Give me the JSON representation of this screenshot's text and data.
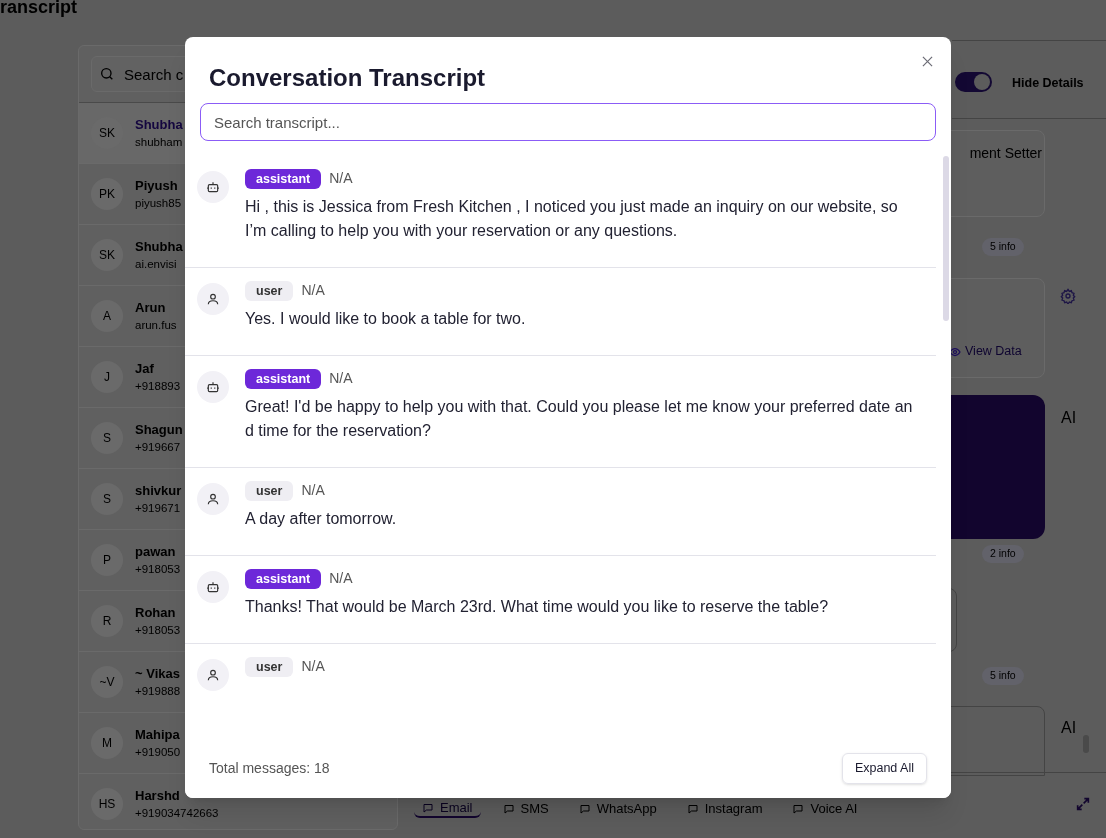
{
  "page": {
    "title": "ranscript"
  },
  "contacts_search": {
    "placeholder": "Search c"
  },
  "contacts": [
    {
      "initials": "SK",
      "name": "Shubha",
      "detail": "shubham",
      "selected": true
    },
    {
      "initials": "PK",
      "name": "Piyush",
      "detail": "piyush85",
      "selected": false
    },
    {
      "initials": "SK",
      "name": "Shubha",
      "detail": "ai.envisi",
      "selected": false
    },
    {
      "initials": "A",
      "name": "Arun",
      "detail": "arun.fus",
      "selected": false
    },
    {
      "initials": "J",
      "name": "Jaf",
      "detail": "+918893",
      "selected": false
    },
    {
      "initials": "S",
      "name": "Shagun",
      "detail": "+919667",
      "selected": false
    },
    {
      "initials": "S",
      "name": "shivkur",
      "detail": "+919671",
      "selected": false
    },
    {
      "initials": "P",
      "name": "pawan",
      "detail": "+918053",
      "selected": false
    },
    {
      "initials": "R",
      "name": "Rohan",
      "detail": "+918053",
      "selected": false
    },
    {
      "initials": "~V",
      "name": "~ Vikas",
      "detail": "+919888",
      "selected": false
    },
    {
      "initials": "M",
      "name": "Mahipa",
      "detail": "+919050",
      "selected": false
    },
    {
      "initials": "HS",
      "name": "Harshd",
      "detail": "+919034742663",
      "selected": false
    }
  ],
  "details": {
    "toggle_on": true,
    "toggle_label": "Hide Details",
    "role_fragment": "ment Setter",
    "info_badges": [
      "5 info",
      "2 info",
      "5 info"
    ],
    "view_data": "View Data",
    "ai_labels": [
      "AI",
      "AI"
    ]
  },
  "channel_tabs": [
    {
      "label": "Email",
      "selected": true
    },
    {
      "label": "SMS",
      "selected": false
    },
    {
      "label": "WhatsApp",
      "selected": false
    },
    {
      "label": "Instagram",
      "selected": false
    },
    {
      "label": "Voice AI",
      "selected": false
    }
  ],
  "modal": {
    "title": "Conversation Transcript",
    "search_placeholder": "Search transcript...",
    "messages": [
      {
        "role": "assistant",
        "time": "N/A",
        "text": "Hi , this is Jessica from Fresh Kitchen , I noticed you just made an inquiry on our website, so I’m calling to help you with your reservation or any questions."
      },
      {
        "role": "user",
        "time": "N/A",
        "text": "Yes. I would like to book a table for two."
      },
      {
        "role": "assistant",
        "time": "N/A",
        "text": "Great! I'd be happy to help you with that. Could you please let me know your preferred date and time for the reservation?"
      },
      {
        "role": "user",
        "time": "N/A",
        "text": "A day after tomorrow."
      },
      {
        "role": "assistant",
        "time": "N/A",
        "text": "Thanks! That would be March 23rd. What time would you like to reserve the table?"
      },
      {
        "role": "user",
        "time": "N/A"
      }
    ],
    "total": "Total messages: 18",
    "expand_button": "Expand All"
  }
}
